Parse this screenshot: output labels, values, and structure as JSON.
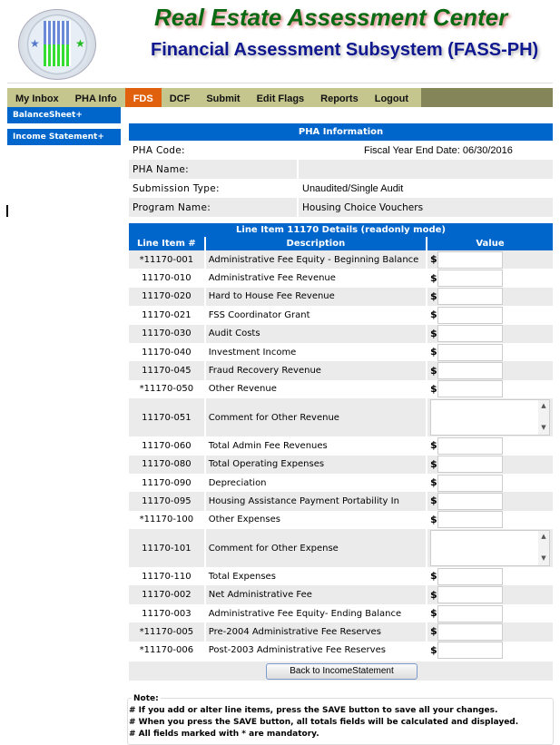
{
  "header": {
    "title": "Real Estate Assessment Center",
    "subtitle": "Financial Assessment Subsystem (FASS-PH)",
    "logo_text": "U.S. Department of Housing and Urban Development"
  },
  "nav": {
    "tabs": [
      "My Inbox",
      "PHA Info",
      "FDS",
      "DCF",
      "Submit",
      "Edit Flags",
      "Reports",
      "Logout"
    ],
    "active": "FDS"
  },
  "sidebar": {
    "items": [
      "BalanceSheet+",
      "Income Statement+"
    ]
  },
  "pha_info": {
    "title": "PHA Information",
    "code_label": "PHA Code:",
    "code_value": "",
    "fiscal_year_end": "Fiscal Year End Date: 06/30/2016",
    "name_label": "PHA Name:",
    "name_value": "",
    "submission_label": "Submission Type:",
    "submission_value": "Unaudited/Single Audit",
    "program_label": "Program Name:",
    "program_value": "Housing Choice Vouchers"
  },
  "details": {
    "title": "Line Item 11170 Details (readonly mode)",
    "columns": [
      "Line Item #",
      "Description",
      "Value"
    ],
    "currency": "$",
    "rows": [
      {
        "id": "*11170-001",
        "desc": "Administrative Fee Equity - Beginning Balance",
        "type": "input",
        "value": ""
      },
      {
        "id": "11170-010",
        "desc": "Administrative Fee Revenue",
        "type": "input",
        "value": ""
      },
      {
        "id": "11170-020",
        "desc": "Hard to House Fee Revenue",
        "type": "input",
        "value": ""
      },
      {
        "id": "11170-021",
        "desc": "FSS Coordinator Grant",
        "type": "input",
        "value": ""
      },
      {
        "id": "11170-030",
        "desc": "Audit Costs",
        "type": "input",
        "value": ""
      },
      {
        "id": "11170-040",
        "desc": "Investment Income",
        "type": "input",
        "value": ""
      },
      {
        "id": "11170-045",
        "desc": "Fraud Recovery Revenue",
        "type": "input",
        "value": ""
      },
      {
        "id": "*11170-050",
        "desc": "Other Revenue",
        "type": "input",
        "value": ""
      },
      {
        "id": "11170-051",
        "desc": "Comment for Other Revenue",
        "type": "textarea",
        "value": ""
      },
      {
        "id": "11170-060",
        "desc": "Total Admin Fee Revenues",
        "type": "input",
        "value": ""
      },
      {
        "id": "11170-080",
        "desc": "Total Operating Expenses",
        "type": "input",
        "value": ""
      },
      {
        "id": "11170-090",
        "desc": "Depreciation",
        "type": "input",
        "value": ""
      },
      {
        "id": "11170-095",
        "desc": "Housing Assistance Payment Portability In",
        "type": "input",
        "value": ""
      },
      {
        "id": "*11170-100",
        "desc": "Other Expenses",
        "type": "input",
        "value": ""
      },
      {
        "id": "11170-101",
        "desc": "Comment for Other Expense",
        "type": "textarea",
        "value": ""
      },
      {
        "id": "11170-110",
        "desc": "Total Expenses",
        "type": "input",
        "value": ""
      },
      {
        "id": "11170-002",
        "desc": "Net Administrative Fee",
        "type": "input",
        "value": ""
      },
      {
        "id": "11170-003",
        "desc": "Administrative Fee Equity- Ending Balance",
        "type": "input",
        "value": ""
      },
      {
        "id": "*11170-005",
        "desc": "Pre-2004 Administrative Fee Reserves",
        "type": "input",
        "value": ""
      },
      {
        "id": "*11170-006",
        "desc": "Post-2003 Administrative Fee Reserves",
        "type": "input",
        "value": ""
      }
    ],
    "back_button": "Back to IncomeStatement"
  },
  "note": {
    "legend": "Note:",
    "lines": [
      "# If you add or alter line items, press the SAVE button to save all your changes.",
      "# When you press the SAVE button, all totals fields will be calculated and displayed.",
      "# All fields marked with * are mandatory."
    ]
  }
}
